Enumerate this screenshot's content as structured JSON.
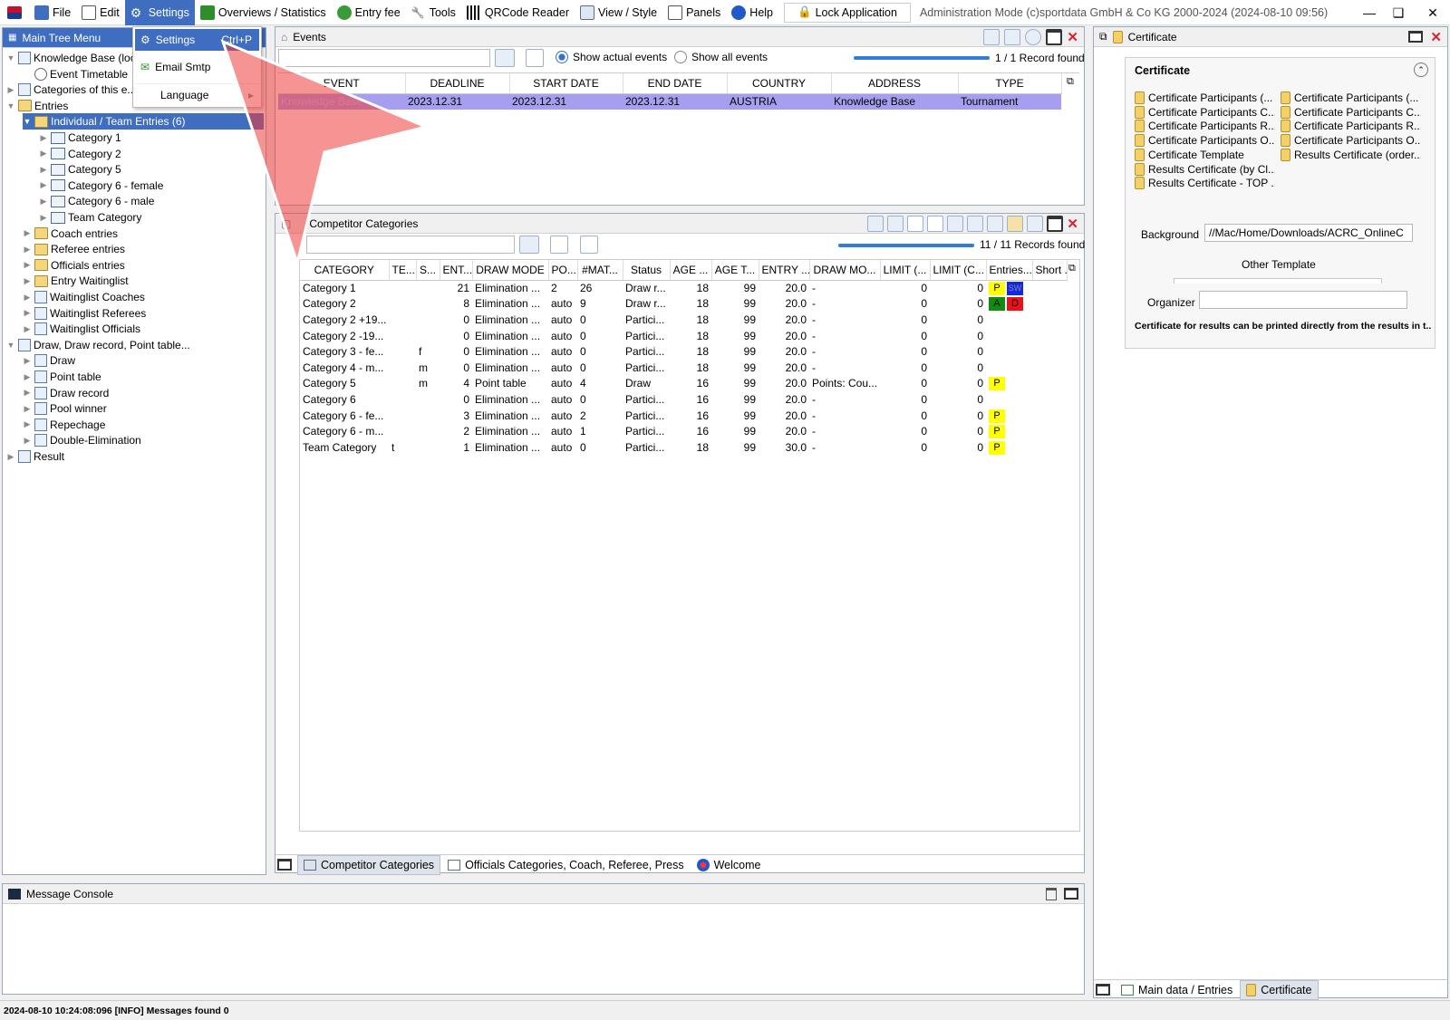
{
  "menubar": {
    "items": [
      {
        "label": "File",
        "icon": "file-icon"
      },
      {
        "label": "Edit",
        "icon": "edit-icon"
      },
      {
        "label": "Settings",
        "icon": "gear-icon"
      },
      {
        "label": "Overviews / Statistics",
        "icon": "statistics-icon"
      },
      {
        "label": "Entry fee",
        "icon": "entry-fee-icon"
      },
      {
        "label": "Tools",
        "icon": "wrench-icon"
      },
      {
        "label": "QRCode Reader",
        "icon": "qrcode-icon"
      },
      {
        "label": "View / Style",
        "icon": "view-icon"
      },
      {
        "label": "Panels",
        "icon": "panels-icon"
      },
      {
        "label": "Help",
        "icon": "help-icon"
      }
    ],
    "lock_label": "Lock Application",
    "title": "Administration Mode (c)sportdata GmbH & Co KG 2000-2024 (2024-08-10 09:56)  v..."
  },
  "dropdown": {
    "items": [
      {
        "label": "Settings",
        "shortcut": "Ctrl+P"
      },
      {
        "label": "Email Smtp",
        "shortcut": ""
      },
      {
        "label": "Language",
        "shortcut": ""
      }
    ]
  },
  "tree": {
    "title": "Main Tree Menu",
    "nodes": [
      {
        "label": "Knowledge Base (local)",
        "level": 0
      },
      {
        "label": "Event Timetable",
        "level": 1
      },
      {
        "label": "Categories of this e...",
        "level": 0
      },
      {
        "label": "Entries",
        "level": 0
      },
      {
        "label": "Individual / Team Entries (6)",
        "level": 1
      },
      {
        "label": "Category 1",
        "level": 2
      },
      {
        "label": "Category 2",
        "level": 2
      },
      {
        "label": "Category 5",
        "level": 2
      },
      {
        "label": "Category 6 - female",
        "level": 2
      },
      {
        "label": "Category 6 - male",
        "level": 2
      },
      {
        "label": "Team Category",
        "level": 2
      },
      {
        "label": "Coach entries",
        "level": 1
      },
      {
        "label": "Referee entries",
        "level": 1
      },
      {
        "label": "Officials entries",
        "level": 1
      },
      {
        "label": "Entry Waitinglist",
        "level": 1
      },
      {
        "label": "Waitinglist Coaches",
        "level": 1
      },
      {
        "label": "Waitinglist Referees",
        "level": 1
      },
      {
        "label": "Waitinglist Officials",
        "level": 1
      },
      {
        "label": "Draw, Draw record, Point table...",
        "level": 0
      },
      {
        "label": "Draw",
        "level": 1
      },
      {
        "label": "Point table",
        "level": 1
      },
      {
        "label": "Draw record",
        "level": 1
      },
      {
        "label": "Pool winner",
        "level": 1
      },
      {
        "label": "Repechage",
        "level": 1
      },
      {
        "label": "Double-Elimination",
        "level": 1
      },
      {
        "label": "Result",
        "level": 0
      }
    ]
  },
  "events": {
    "title": "Events",
    "radio_actual": "Show actual events",
    "radio_all": "Show all events",
    "record_count": "1 / 1 Record found",
    "progress": 1.0,
    "columns": [
      "EVENT",
      "DEADLINE",
      "START DATE",
      "END DATE",
      "COUNTRY",
      "ADDRESS",
      "TYPE"
    ],
    "rows": [
      [
        "Knowledge Base",
        "2023.12.31",
        "2023.12.31",
        "2023.12.31",
        "AUSTRIA",
        "Knowledge Base",
        "Tournament"
      ]
    ]
  },
  "categories": {
    "title": "Competitor Categories",
    "record_count": "11 / 11 Records found",
    "progress": 1.0,
    "columns": [
      "CATEGORY",
      "TE...",
      "S...",
      "ENT...",
      "DRAW MODE",
      "PO...",
      "#MAT...",
      "Status",
      "AGE ...",
      "AGE T...",
      "ENTRY ...",
      "DRAW MO...",
      "LIMIT (...",
      "LIMIT (C...",
      "Entries...",
      "Short ..."
    ],
    "rows": [
      [
        "Category 1",
        "",
        "",
        "21",
        "Elimination ...",
        "2",
        "26",
        "Draw r...",
        "18",
        "99",
        "20.0",
        "-",
        "0",
        "0",
        "P|SW",
        ""
      ],
      [
        "Category 2",
        "",
        "",
        "8",
        "Elimination ...",
        "auto",
        "9",
        "Draw r...",
        "18",
        "99",
        "20.0",
        "-",
        "0",
        "0",
        "A|D",
        ""
      ],
      [
        "Category 2 +19...",
        "",
        "",
        "0",
        "Elimination ...",
        "auto",
        "0",
        "Partici...",
        "18",
        "99",
        "20.0",
        "-",
        "0",
        "0",
        "",
        ""
      ],
      [
        "Category 2 -19...",
        "",
        "",
        "0",
        "Elimination ...",
        "auto",
        "0",
        "Partici...",
        "18",
        "99",
        "20.0",
        "-",
        "0",
        "0",
        "",
        ""
      ],
      [
        "Category 3 - fe...",
        "",
        "f",
        "0",
        "Elimination ...",
        "auto",
        "0",
        "Partici...",
        "18",
        "99",
        "20.0",
        "-",
        "0",
        "0",
        "",
        ""
      ],
      [
        "Category 4 - m...",
        "",
        "m",
        "0",
        "Elimination ...",
        "auto",
        "0",
        "Partici...",
        "18",
        "99",
        "20.0",
        "-",
        "0",
        "0",
        "",
        ""
      ],
      [
        "Category 5",
        "",
        "m",
        "4",
        "Point table",
        "auto",
        "4",
        "Draw",
        "16",
        "99",
        "20.0",
        "Points: Cou...",
        "0",
        "0",
        "P",
        ""
      ],
      [
        "Category 6",
        "",
        "",
        "0",
        "Elimination ...",
        "auto",
        "0",
        "Partici...",
        "16",
        "99",
        "20.0",
        "-",
        "0",
        "0",
        "",
        ""
      ],
      [
        "Category 6 - fe...",
        "",
        "",
        "3",
        "Elimination ...",
        "auto",
        "2",
        "Partici...",
        "16",
        "99",
        "20.0",
        "-",
        "0",
        "0",
        "P",
        ""
      ],
      [
        "Category 6 - m...",
        "",
        "",
        "2",
        "Elimination ...",
        "auto",
        "1",
        "Partici...",
        "16",
        "99",
        "20.0",
        "-",
        "0",
        "0",
        "P",
        ""
      ],
      [
        "Team Category",
        "t",
        "",
        "1",
        "Elimination ...",
        "auto",
        "0",
        "Partici...",
        "18",
        "99",
        "30.0",
        "-",
        "0",
        "0",
        "P",
        ""
      ]
    ],
    "tabs": [
      "Competitor Categories",
      "Officials Categories, Coach, Referee, Press",
      "Welcome"
    ]
  },
  "certificate": {
    "title": "Certificate",
    "section_title": "Certificate",
    "items_left": [
      "Certificate Participants (...",
      "Certificate Participants C...",
      "Certificate Participants R...",
      "Certificate Participants O...",
      "Certificate Template",
      "Results Certificate (by Cl...",
      "Results Certificate - TOP ..."
    ],
    "items_right": [
      "Certificate Participants (...",
      "Certificate Participants C...",
      "Certificate Participants R...",
      "Certificate Participants O...",
      "Results Certificate (order..."
    ],
    "background_label": "Background",
    "background_value": "//Mac/Home/Downloads/ACRC_OnlineC",
    "other_template_label": "Other Template",
    "organizer_label": "Organizer",
    "note": "Certificate for results can be printed directly from the results in t...",
    "tabs": [
      "Main data / Entries",
      "Certificate"
    ]
  },
  "console": {
    "title": "Message Console"
  },
  "statusbar": {
    "text": "2024-08-10 10:24:08:096 [INFO] Messages found 0"
  },
  "colors": {
    "selection": "#3f6dbf",
    "event_row": "#a79ef0",
    "badge_yellow": "#ffff00",
    "badge_blue": "#1028e8",
    "badge_green": "#138a13",
    "badge_red": "#e8101a"
  }
}
